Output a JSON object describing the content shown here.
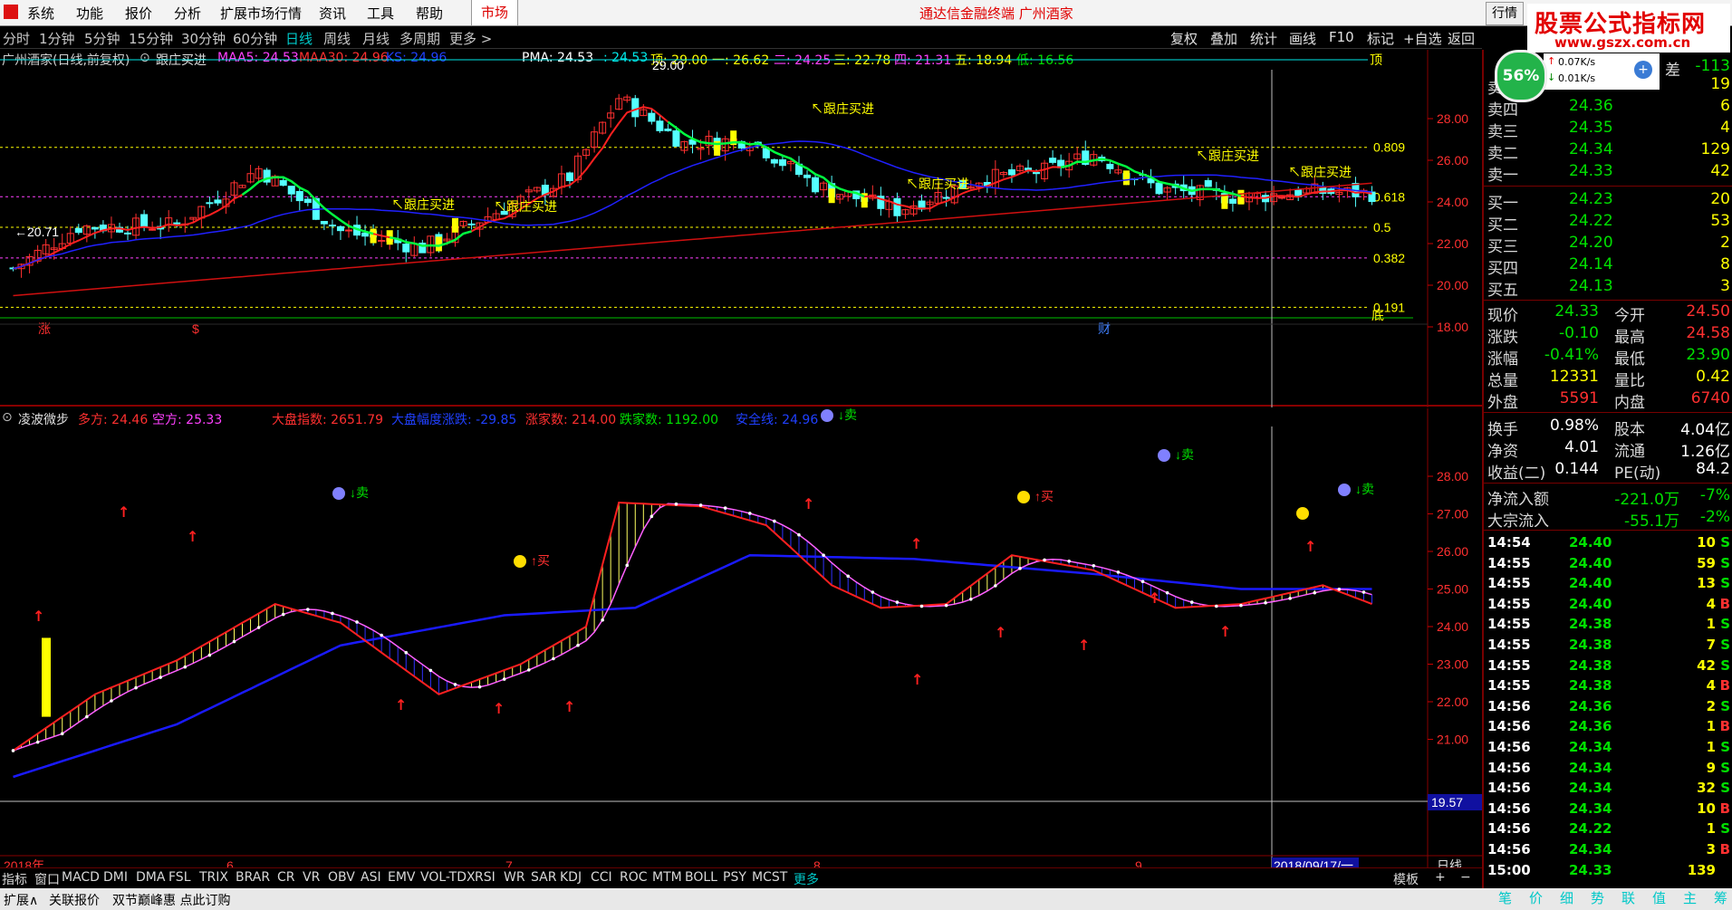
{
  "menu": {
    "items": [
      "系统",
      "功能",
      "报价",
      "分析",
      "扩展市场行情",
      "资讯",
      "工具",
      "帮助"
    ],
    "market_tab": "市场",
    "app_title": "通达信金融终端  广州酒家",
    "quote_button": "行情"
  },
  "banner": {
    "title": "股票公式指标网",
    "url": "www.gszx.com.cn"
  },
  "periods": {
    "items": [
      "分时",
      "1分钟",
      "5分钟",
      "15分钟",
      "30分钟",
      "60分钟",
      "日线",
      "周线",
      "月线",
      "多周期",
      "更多 >"
    ],
    "active": "日线"
  },
  "toolbar": [
    "复权",
    "叠加",
    "统计",
    "画线",
    "F10",
    "标记",
    "+自选",
    "返回"
  ],
  "main_info": {
    "stock": "广州酒家(日线,前复权)",
    "formula": "跟庄买进",
    "maa5": "MAA5: 24.53",
    "maa30": "MAA30: 24.96",
    "ks": "KS: 24.96",
    "pma": "PMA: 24.53",
    "v1": ": 24.53",
    "top": "顶: 29.00",
    "one": "一: 26.62",
    "two": "二: 24.25",
    "three": "三: 22.78",
    "four": "四: 21.31",
    "five": "五: 18.94",
    "low": "低: 16.56"
  },
  "main_axis": [
    "28.00",
    "26.00",
    "24.00",
    "22.00",
    "20.00",
    "18.00"
  ],
  "fib_labels": [
    "0.809",
    "0.618",
    "0.5",
    "0.382",
    "0.191"
  ],
  "main_labels": {
    "high_mark": "29.00",
    "low_mark": "20.71",
    "buy": "跟庄买进",
    "bottom": "底",
    "top_mark": "顶",
    "zhang": "涨",
    "cai": "财",
    "dollar": "$"
  },
  "sub_info": {
    "name": "凌波微步",
    "duo": "多方: 24.46",
    "kong": "空方: 25.33",
    "dapan": "大盘指数: 2651.79",
    "dapan_change": "大盘幅度涨跌: -29.85",
    "up_count": "涨家数: 214.00",
    "down_count": "跌家数: 1192.00",
    "safe": "安全线: 24.96"
  },
  "sub_axis": [
    "28.00",
    "27.00",
    "26.00",
    "25.00",
    "24.00",
    "23.00",
    "22.00",
    "21.00"
  ],
  "sub_labels": {
    "buy": "↑买",
    "sell": "↓卖",
    "price_mark": "19.57"
  },
  "x_axis": {
    "labels": [
      "2018年",
      "6",
      "7",
      "8",
      "9"
    ],
    "cursor_date": "2018/09/17/一",
    "period": "日线"
  },
  "indicators": [
    "指标",
    "窗口",
    "MACD",
    "DMI",
    "DMA",
    "FSL",
    "TRIX",
    "BRAR",
    "CR",
    "VR",
    "OBV",
    "ASI",
    "EMV",
    "VOL-TDX",
    "RSI",
    "WR",
    "SAR",
    "KDJ",
    "CCI",
    "ROC",
    "MTM",
    "BOLL",
    "PSY",
    "MCST",
    "更多"
  ],
  "indicators_right": [
    "模板",
    "+",
    "−"
  ],
  "status": [
    "扩展∧",
    "关联报价",
    "双节巅峰惠 点此订购"
  ],
  "network": {
    "percent": "56%",
    "up": "0.07K/s",
    "down": "0.01K/s"
  },
  "right_panel": {
    "cha_label": "差",
    "cha_value": "-113",
    "asks": [
      {
        "label": "卖五",
        "price": "24.37",
        "vol": "19"
      },
      {
        "label": "卖四",
        "price": "24.36",
        "vol": "6"
      },
      {
        "label": "卖三",
        "price": "24.35",
        "vol": "4"
      },
      {
        "label": "卖二",
        "price": "24.34",
        "vol": "129"
      },
      {
        "label": "卖一",
        "price": "24.33",
        "vol": "42"
      }
    ],
    "bids": [
      {
        "label": "买一",
        "price": "24.23",
        "vol": "20"
      },
      {
        "label": "买二",
        "price": "24.22",
        "vol": "53"
      },
      {
        "label": "买三",
        "price": "24.20",
        "vol": "2"
      },
      {
        "label": "买四",
        "price": "24.14",
        "vol": "8"
      },
      {
        "label": "买五",
        "price": "24.13",
        "vol": "3"
      }
    ],
    "stats": [
      {
        "l1": "现价",
        "v1": "24.33",
        "l2": "今开",
        "v2": "24.50"
      },
      {
        "l1": "涨跌",
        "v1": "-0.10",
        "l2": "最高",
        "v2": "24.58"
      },
      {
        "l1": "涨幅",
        "v1": "-0.41%",
        "l2": "最低",
        "v2": "23.90"
      },
      {
        "l1": "总量",
        "v1": "12331",
        "l2": "量比",
        "v2": "0.42"
      },
      {
        "l1": "外盘",
        "v1": "5591",
        "l2": "内盘",
        "v2": "6740"
      }
    ],
    "stats2": [
      {
        "l1": "换手",
        "v1": "0.98%",
        "l2": "股本",
        "v2": "4.04亿"
      },
      {
        "l1": "净资",
        "v1": "4.01",
        "l2": "流通",
        "v2": "1.26亿"
      },
      {
        "l1": "收益(二)",
        "v1": "0.144",
        "l2": "PE(动)",
        "v2": "84.2"
      }
    ],
    "flow": [
      {
        "label": "净流入额",
        "value": "-221.0万",
        "pct": "-7%"
      },
      {
        "label": "大宗流入",
        "value": "-55.1万",
        "pct": "-2%"
      }
    ],
    "ticks": [
      {
        "time": "14:54",
        "price": "24.40",
        "vol": "10",
        "dir": "S"
      },
      {
        "time": "14:55",
        "price": "24.40",
        "vol": "59",
        "dir": "S"
      },
      {
        "time": "14:55",
        "price": "24.40",
        "vol": "13",
        "dir": "S"
      },
      {
        "time": "14:55",
        "price": "24.40",
        "vol": "4",
        "dir": "B"
      },
      {
        "time": "14:55",
        "price": "24.38",
        "vol": "1",
        "dir": "S"
      },
      {
        "time": "14:55",
        "price": "24.38",
        "vol": "7",
        "dir": "S"
      },
      {
        "time": "14:55",
        "price": "24.38",
        "vol": "42",
        "dir": "S"
      },
      {
        "time": "14:55",
        "price": "24.38",
        "vol": "4",
        "dir": "B"
      },
      {
        "time": "14:56",
        "price": "24.36",
        "vol": "2",
        "dir": "S"
      },
      {
        "time": "14:56",
        "price": "24.36",
        "vol": "1",
        "dir": "B"
      },
      {
        "time": "14:56",
        "price": "24.34",
        "vol": "1",
        "dir": "S"
      },
      {
        "time": "14:56",
        "price": "24.34",
        "vol": "9",
        "dir": "S"
      },
      {
        "time": "14:56",
        "price": "24.34",
        "vol": "32",
        "dir": "S"
      },
      {
        "time": "14:56",
        "price": "24.34",
        "vol": "10",
        "dir": "B"
      },
      {
        "time": "14:56",
        "price": "24.22",
        "vol": "1",
        "dir": "S"
      },
      {
        "time": "14:56",
        "price": "24.34",
        "vol": "3",
        "dir": "B"
      },
      {
        "time": "15:00",
        "price": "24.33",
        "vol": "139",
        "dir": ""
      }
    ],
    "tabs": [
      "笔",
      "价",
      "细",
      "势",
      "联",
      "值",
      "主",
      "筹"
    ]
  },
  "colors": {
    "up": "#ff3030",
    "down": "#00e000",
    "ma_red": "#ff2020",
    "ma_blue": "#2020ff",
    "fib": "#ffff00",
    "purple": "#ff40ff",
    "candle_up": "#ff3030",
    "candle_down": "#54ffff"
  }
}
